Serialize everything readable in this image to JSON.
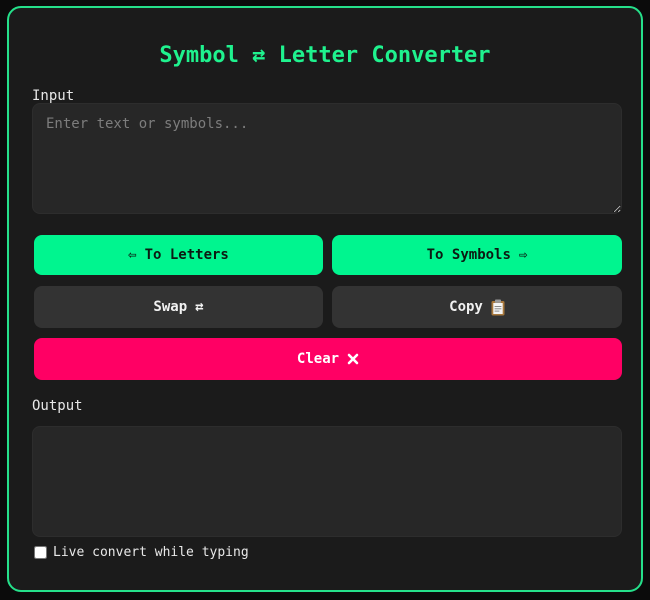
{
  "app": {
    "title": "Symbol ⇄ Letter Converter"
  },
  "input": {
    "label": "Input",
    "placeholder": "Enter text or symbols...",
    "value": ""
  },
  "buttons": {
    "to_letters": {
      "label": "To Letters",
      "icon": "arrow-left-icon",
      "glyph": "⇦"
    },
    "to_symbols": {
      "label": "To Symbols",
      "icon": "arrow-right-icon",
      "glyph": "⇨"
    },
    "swap": {
      "label": "Swap",
      "icon": "swap-arrows-icon",
      "glyph": "⇄"
    },
    "copy": {
      "label": "Copy",
      "icon": "clipboard-icon"
    },
    "clear": {
      "label": "Clear",
      "icon": "close-icon"
    }
  },
  "output": {
    "label": "Output",
    "value": ""
  },
  "live_convert": {
    "label": "Live convert while typing",
    "checked": false
  },
  "colors": {
    "accent": "#00f58f",
    "border": "#25e08a",
    "danger": "#ff0064",
    "panel_bg": "#1b1b1b",
    "field_bg": "#272727",
    "secondary_button": "#333333"
  }
}
